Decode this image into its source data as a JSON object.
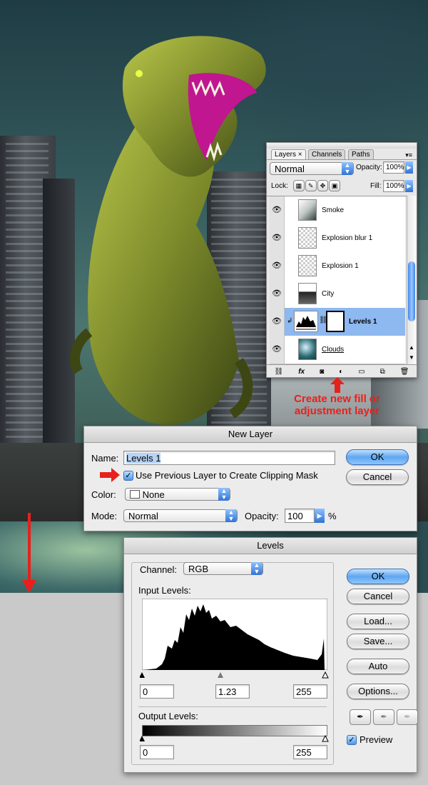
{
  "layers_panel": {
    "tabs": [
      "Layers",
      "Channels",
      "Paths"
    ],
    "tab_close_glyph": "×",
    "blend_mode": "Normal",
    "opacity_label": "Opacity:",
    "opacity_value": "100%",
    "lock_label": "Lock:",
    "fill_label": "Fill:",
    "fill_value": "100%",
    "layers": [
      {
        "name": "Smoke",
        "selected": false
      },
      {
        "name": "Explosion blur 1",
        "selected": false
      },
      {
        "name": "Explosion 1",
        "selected": false
      },
      {
        "name": "City",
        "selected": false
      },
      {
        "name": "Levels 1",
        "selected": true
      },
      {
        "name": "Clouds",
        "selected": false
      }
    ],
    "footer_icons": [
      "link-icon",
      "fx-icon",
      "mask-icon",
      "adjustment-layer-icon",
      "folder-icon",
      "new-layer-icon",
      "trash-icon"
    ]
  },
  "callout": {
    "line1": "Create new fill or",
    "line2": "adjustment layer",
    "color": "#e8201c"
  },
  "new_layer_dialog": {
    "title": "New Layer",
    "name_label": "Name:",
    "name_value": "Levels 1",
    "clipping_label": "Use Previous Layer to Create Clipping Mask",
    "clipping_checked": true,
    "color_label": "Color:",
    "color_value": "None",
    "mode_label": "Mode:",
    "mode_value": "Normal",
    "opacity_label": "Opacity:",
    "opacity_value": "100",
    "percent": "%",
    "ok_label": "OK",
    "cancel_label": "Cancel"
  },
  "levels_dialog": {
    "title": "Levels",
    "channel_label": "Channel:",
    "channel_value": "RGB",
    "input_levels_label": "Input Levels:",
    "input_black": "0",
    "input_gamma": "1.23",
    "input_white": "255",
    "output_levels_label": "Output Levels:",
    "output_black": "0",
    "output_white": "255",
    "ok_label": "OK",
    "cancel_label": "Cancel",
    "load_label": "Load...",
    "save_label": "Save...",
    "auto_label": "Auto",
    "options_label": "Options...",
    "preview_label": "Preview",
    "preview_checked": true
  }
}
